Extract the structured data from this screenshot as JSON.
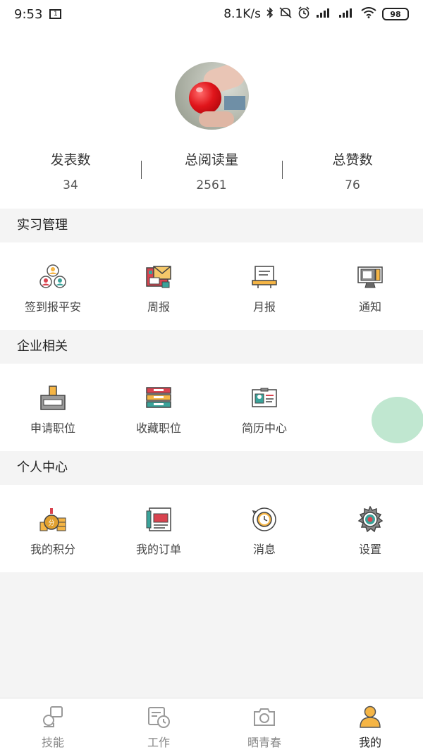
{
  "status_bar": {
    "time": "9:53",
    "notif_badge": "1",
    "net_speed": "8.1K/s",
    "battery": "98"
  },
  "profile": {
    "stats": [
      {
        "label": "发表数",
        "value": "34"
      },
      {
        "label": "总阅读量",
        "value": "2561"
      },
      {
        "label": "总赞数",
        "value": "76"
      }
    ]
  },
  "sections": {
    "internship": {
      "title": "实习管理",
      "items": [
        {
          "label": "签到报平安",
          "icon": "checkin-people-icon"
        },
        {
          "label": "周报",
          "icon": "weekly-report-icon"
        },
        {
          "label": "月报",
          "icon": "monthly-report-icon"
        },
        {
          "label": "通知",
          "icon": "notice-icon"
        }
      ]
    },
    "enterprise": {
      "title": "企业相关",
      "items": [
        {
          "label": "申请职位",
          "icon": "apply-job-icon"
        },
        {
          "label": "收藏职位",
          "icon": "saved-jobs-icon"
        },
        {
          "label": "简历中心",
          "icon": "resume-icon"
        }
      ]
    },
    "personal": {
      "title": "个人中心",
      "items": [
        {
          "label": "我的积分",
          "icon": "points-coins-icon"
        },
        {
          "label": "我的订单",
          "icon": "orders-icon"
        },
        {
          "label": "消息",
          "icon": "message-clock-icon"
        },
        {
          "label": "设置",
          "icon": "settings-gear-icon"
        }
      ]
    }
  },
  "tabbar": {
    "tabs": [
      {
        "label": "技能",
        "icon": "skills-icon",
        "active": false
      },
      {
        "label": "工作",
        "icon": "work-calendar-icon",
        "active": false
      },
      {
        "label": "晒青春",
        "icon": "camera-icon",
        "active": false
      },
      {
        "label": "我的",
        "icon": "profile-user-icon",
        "active": true
      }
    ]
  },
  "colors": {
    "accent_orange": "#f5b545",
    "fab_green": "#bde6cd",
    "icon_teal": "#3aa39a",
    "icon_red": "#d9434f"
  }
}
